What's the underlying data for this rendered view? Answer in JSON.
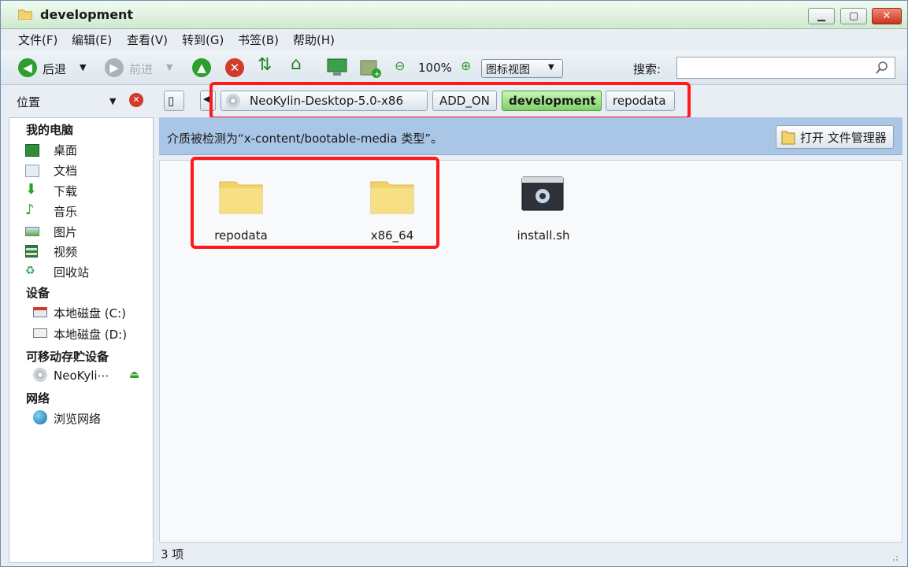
{
  "window": {
    "title": "development"
  },
  "menu": [
    "文件(F)",
    "编辑(E)",
    "查看(V)",
    "转到(G)",
    "书签(B)",
    "帮助(H)"
  ],
  "toolbar": {
    "back": "后退",
    "forward": "前进",
    "zoom": "100%",
    "view": "图标视图",
    "search_label": "搜索:",
    "search_value": ""
  },
  "location": {
    "sidebar_label": "位置",
    "crumbs": [
      "NeoKylin-Desktop-5.0-x86",
      "ADD_ON",
      "development",
      "repodata"
    ],
    "active": "development"
  },
  "sidebar": {
    "sections": [
      {
        "heading": "我的电脑",
        "items": [
          "桌面",
          "文档",
          "下载",
          "音乐",
          "图片",
          "视频",
          "回收站"
        ]
      },
      {
        "heading": "设备",
        "items": [
          "本地磁盘 (C:)",
          "本地磁盘 (D:)"
        ]
      },
      {
        "heading": "可移动存贮设备",
        "items": [
          "NeoKyli⋯"
        ]
      },
      {
        "heading": "网络",
        "items": [
          "浏览网络"
        ]
      }
    ]
  },
  "infobar": {
    "message": "介质被检测为“x-content/bootable-media 类型”。",
    "button": "打开 文件管理器"
  },
  "files": [
    {
      "name": "repodata",
      "type": "folder"
    },
    {
      "name": "x86_64",
      "type": "folder"
    },
    {
      "name": "install.sh",
      "type": "script"
    }
  ],
  "status": "3 项",
  "colors": {
    "highlight": "#ff1a1a",
    "active_crumb": "#7fd167",
    "infobar": "#a9c6e6"
  }
}
